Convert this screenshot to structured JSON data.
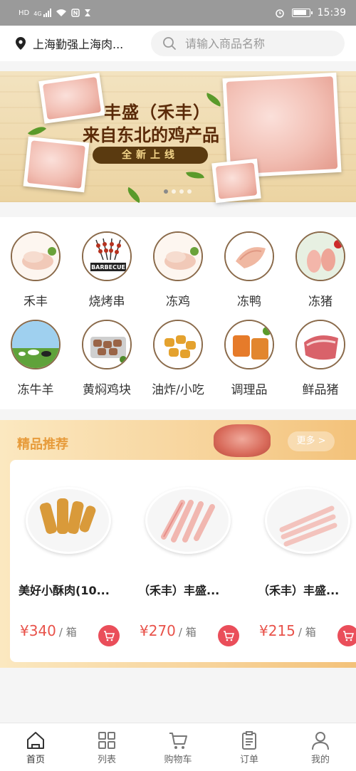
{
  "status_bar": {
    "left_icons": [
      "hd-icon",
      "4g-signal-icon",
      "wifi-icon",
      "nfc-icon",
      "hourglass-icon"
    ],
    "hd": "HD",
    "net": "4G",
    "time": "15:39"
  },
  "header": {
    "location": "上海勤强上海肉...",
    "search_placeholder": "请输入商品名称"
  },
  "banner": {
    "title": "丰盛（禾丰）",
    "subtitle": "来自东北的鸡产品",
    "tag": "全新上线",
    "pages": 4,
    "active_page": 1
  },
  "categories": [
    {
      "label": "禾丰",
      "icon": "chicken-leg-icon"
    },
    {
      "label": "烧烤串",
      "icon": "barbecue-icon"
    },
    {
      "label": "冻鸡",
      "icon": "chicken-leg-icon"
    },
    {
      "label": "冻鸭",
      "icon": "duck-icon"
    },
    {
      "label": "冻猪",
      "icon": "pork-trotter-icon"
    },
    {
      "label": "冻牛羊",
      "icon": "cattle-icon"
    },
    {
      "label": "黄焖鸡块",
      "icon": "braised-chicken-icon"
    },
    {
      "label": "油炸/小吃",
      "icon": "nugget-icon"
    },
    {
      "label": "调理品",
      "icon": "prepared-meat-icon"
    },
    {
      "label": "鲜品猪",
      "icon": "fresh-pork-icon"
    }
  ],
  "recommend": {
    "title": "精品推荐",
    "more": "更多 >",
    "products": [
      {
        "name": "美好小酥肉(10...",
        "price": "¥340",
        "unit": "/ 箱"
      },
      {
        "name": "（禾丰）丰盛...",
        "price": "¥270",
        "unit": "/ 箱"
      },
      {
        "name": "（禾丰）丰盛...",
        "price": "¥215",
        "unit": "/ 箱"
      }
    ]
  },
  "nav": [
    {
      "label": "首页",
      "icon": "home-icon",
      "active": true
    },
    {
      "label": "列表",
      "icon": "grid-icon",
      "active": false
    },
    {
      "label": "购物车",
      "icon": "cart-icon",
      "active": false
    },
    {
      "label": "订单",
      "icon": "order-icon",
      "active": false
    },
    {
      "label": "我的",
      "icon": "user-icon",
      "active": false
    }
  ],
  "colors": {
    "accent": "#e79b3a",
    "price": "#e8524a",
    "cart": "#ea4e5a",
    "status_bar": "#9a9a9a"
  }
}
